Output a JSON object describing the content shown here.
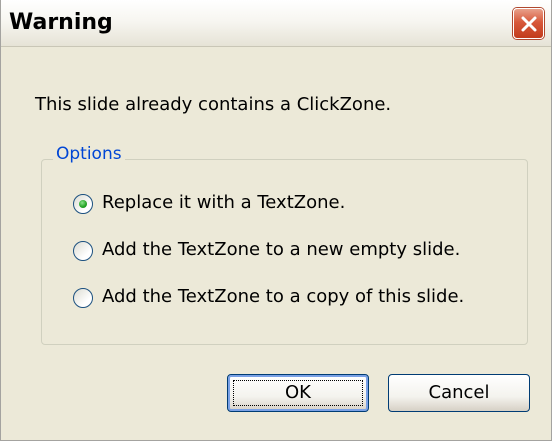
{
  "window": {
    "title": "Warning",
    "close_icon": "close-icon"
  },
  "message": "This slide already contains a ClickZone.",
  "options": {
    "label": "Options",
    "items": [
      {
        "label": "Replace it with a TextZone.",
        "selected": true
      },
      {
        "label": "Add the TextZone to a new empty slide.",
        "selected": false
      },
      {
        "label": "Add the TextZone to a copy of this slide.",
        "selected": false
      }
    ]
  },
  "buttons": {
    "ok_label": "OK",
    "cancel_label": "Cancel"
  },
  "colors": {
    "dialog_bg": "#ece9d8",
    "group_label": "#0046d5",
    "close_button": "#d8593b",
    "radio_selected": "#21a121"
  }
}
